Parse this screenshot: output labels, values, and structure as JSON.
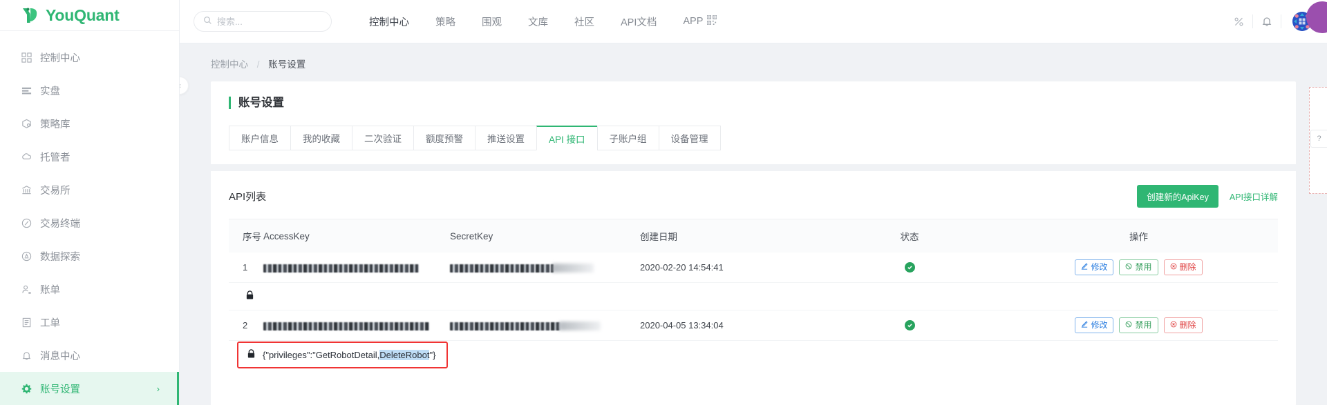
{
  "brand": {
    "name": "YouQuant",
    "logo_icon": "leaf-logo-icon"
  },
  "sidebar": {
    "items": [
      {
        "label": "控制中心",
        "icon": "dashboard-icon",
        "active": false
      },
      {
        "label": "实盘",
        "icon": "list-icon",
        "active": false
      },
      {
        "label": "策略库",
        "icon": "box-icon",
        "active": false
      },
      {
        "label": "托管者",
        "icon": "cloud-icon",
        "active": false
      },
      {
        "label": "交易所",
        "icon": "bank-icon",
        "active": false
      },
      {
        "label": "交易终端",
        "icon": "terminal-icon",
        "active": false
      },
      {
        "label": "数据探索",
        "icon": "database-icon",
        "active": false
      },
      {
        "label": "账单",
        "icon": "user-bill-icon",
        "active": false
      },
      {
        "label": "工单",
        "icon": "ticket-icon",
        "active": false
      },
      {
        "label": "消息中心",
        "icon": "bell-icon",
        "active": false
      },
      {
        "label": "账号设置",
        "icon": "gear-icon",
        "active": true,
        "chevron": "›"
      }
    ]
  },
  "topbar": {
    "search": {
      "value": "",
      "placeholder": "搜索...",
      "icon": "search-icon"
    },
    "nav": [
      {
        "label": "控制中心",
        "active": true
      },
      {
        "label": "策略",
        "active": false
      },
      {
        "label": "围观",
        "active": false
      },
      {
        "label": "文库",
        "active": false
      },
      {
        "label": "社区",
        "active": false
      },
      {
        "label": "API文档",
        "active": false
      },
      {
        "label": "APP",
        "active": false,
        "icon": "qrcode-icon"
      }
    ],
    "icons": [
      {
        "name": "theme-toggle-icon"
      },
      {
        "name": "notification-bell-icon"
      }
    ],
    "avatar": {
      "name": "user-avatar"
    },
    "widget": {
      "name": "support-chat-widget"
    }
  },
  "breadcrumb": {
    "root": "控制中心",
    "separator": "/",
    "current": "账号设置"
  },
  "collapse_handle": {
    "icon": "chevron-left-icon"
  },
  "help_tab": {
    "icon": "question-mark-icon",
    "label": "?"
  },
  "page": {
    "title": "账号设置",
    "tabs": [
      {
        "label": "账户信息",
        "active": false
      },
      {
        "label": "我的收藏",
        "active": false
      },
      {
        "label": "二次验证",
        "active": false
      },
      {
        "label": "额度预警",
        "active": false
      },
      {
        "label": "推送设置",
        "active": false
      },
      {
        "label": "API 接口",
        "active": true
      },
      {
        "label": "子账户组",
        "active": false
      },
      {
        "label": "设备管理",
        "active": false
      }
    ]
  },
  "api_list": {
    "title": "API列表",
    "create_button": "创建新的ApiKey",
    "detail_link": "API接口详解",
    "columns": [
      "序号",
      "AccessKey",
      "SecretKey",
      "创建日期",
      "状态",
      "操作"
    ],
    "rows": [
      {
        "index": "1",
        "access_key": "",
        "secret_key": "",
        "created_at": "2020-02-20 14:54:41",
        "status_icon": "status-active-check-icon",
        "actions": [
          {
            "label": "修改",
            "icon": "edit-icon",
            "style": "edit"
          },
          {
            "label": "禁用",
            "icon": "ban-icon",
            "style": "ban"
          },
          {
            "label": "删除",
            "icon": "delete-icon",
            "style": "delete"
          }
        ],
        "privileges": {
          "lock_icon": "lock-icon",
          "text": "",
          "highlighted": "",
          "boxed": false
        }
      },
      {
        "index": "2",
        "access_key": "",
        "secret_key": "",
        "created_at": "2020-04-05 13:34:04",
        "status_icon": "status-active-check-icon",
        "actions": [
          {
            "label": "修改",
            "icon": "edit-icon",
            "style": "edit"
          },
          {
            "label": "禁用",
            "icon": "ban-icon",
            "style": "ban"
          },
          {
            "label": "删除",
            "icon": "delete-icon",
            "style": "delete"
          }
        ],
        "privileges": {
          "lock_icon": "lock-icon",
          "prefix": "{\"privileges\":\"GetRobotDetail,",
          "highlighted": "DeleteRobot",
          "suffix": "\"}",
          "boxed": true
        }
      }
    ]
  },
  "colors": {
    "brand_green": "#2fb673",
    "active_bg": "#e6f7ef",
    "highlight_box": "#f03434",
    "selection": "#bedcf5",
    "edit_blue": "#2b7ee0",
    "ban_green": "#38a05f",
    "delete_red": "#e04545"
  }
}
